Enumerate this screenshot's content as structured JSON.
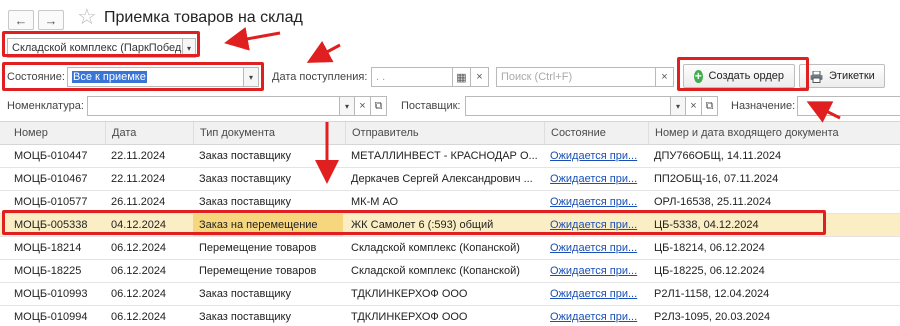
{
  "nav": {
    "back_glyph": "←",
    "forward_glyph": "→"
  },
  "title": "Приемка товаров на склад",
  "warehouse": {
    "value": "Складской комплекс (ПаркПобед"
  },
  "filters": {
    "state_label": "Состояние:",
    "state_value": "Все к приемке",
    "date_label": "Дата поступления:",
    "date_value": ". .",
    "search_placeholder": "Поиск (Ctrl+F)",
    "nomenclature_label": "Номенклатура:",
    "supplier_label": "Поставщик:",
    "purpose_label": "Назначение:"
  },
  "buttons": {
    "create_order": "Создать ордер",
    "labels": "Этикетки",
    "clear": "×",
    "copy": "⧉",
    "dropdown": "▾",
    "calendar": "▦"
  },
  "table": {
    "columns": [
      "Номер",
      "Дата",
      "Тип документа",
      "Отправитель",
      "Состояние",
      "Номер и дата входящего документа"
    ],
    "rows": [
      [
        "МОЦБ-010447",
        "22.11.2024",
        "Заказ поставщику",
        "МЕТАЛЛИНВЕСТ - КРАСНОДАР О...",
        "Ожидается при...",
        "ДПУ766ОБЩ, 14.11.2024"
      ],
      [
        "МОЦБ-010467",
        "22.11.2024",
        "Заказ поставщику",
        "Деркачев Сергей Александрович ...",
        "Ожидается при...",
        "ПП2ОБЩ-16, 07.11.2024"
      ],
      [
        "МОЦБ-010577",
        "26.11.2024",
        "Заказ поставщику",
        "МК-М АО",
        "Ожидается при...",
        "ОРЛ-16538, 25.11.2024"
      ],
      [
        "МОЦБ-005338",
        "04.12.2024",
        "Заказ на перемещение",
        "ЖК Самолет 6 (:593) общий",
        "Ожидается при...",
        "ЦБ-5338, 04.12.2024"
      ],
      [
        "МОЦБ-18214",
        "06.12.2024",
        "Перемещение товаров",
        "Складской комплекс (Копанской)",
        "Ожидается при...",
        "ЦБ-18214, 06.12.2024"
      ],
      [
        "МОЦБ-18225",
        "06.12.2024",
        "Перемещение товаров",
        "Складской комплекс (Копанской)",
        "Ожидается при...",
        "ЦБ-18225, 06.12.2024"
      ],
      [
        "МОЦБ-010993",
        "06.12.2024",
        "Заказ поставщику",
        "ТДКЛИНКЕРХОФ ООО",
        "Ожидается при...",
        "Р2Л1-1158, 12.04.2024"
      ],
      [
        "МОЦБ-010994",
        "06.12.2024",
        "Заказ поставщику",
        "ТДКЛИНКЕРХОФ ООО",
        "Ожидается при...",
        "Р2Л3-1095, 20.03.2024"
      ]
    ],
    "selected_row": 3
  },
  "colors": {
    "annotation_red": "#e02020",
    "selected_row_bg": "#fbeec4",
    "link_blue": "#1a4fb5",
    "accent_green": "#3fae4b"
  },
  "icons": [
    "back-arrow-icon",
    "forward-arrow-icon",
    "favorite-star-icon",
    "calendar-icon",
    "plus-circle-icon",
    "printer-icon"
  ]
}
